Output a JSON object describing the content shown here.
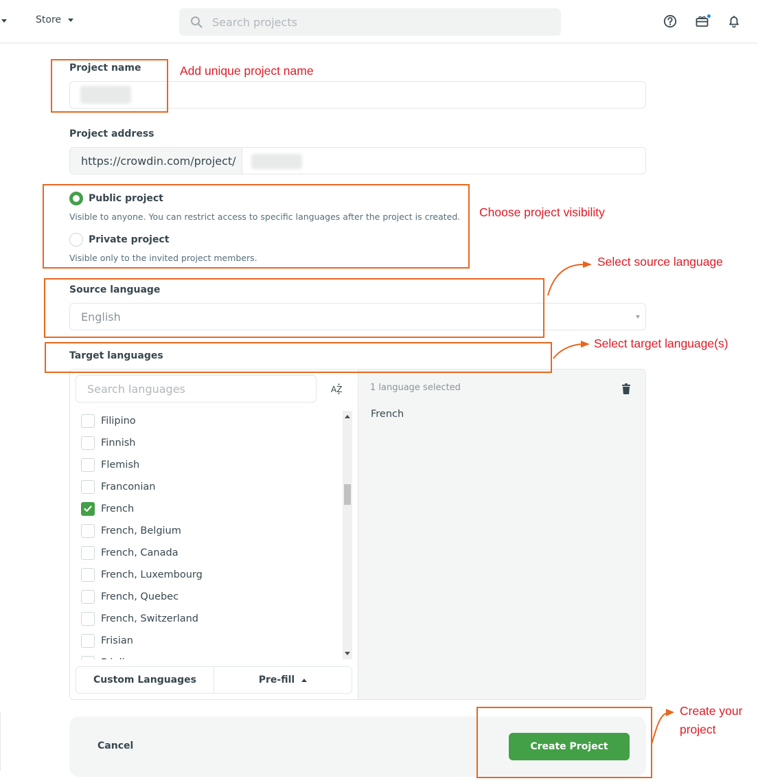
{
  "topbar": {
    "store_label": "Store",
    "search_placeholder": "Search projects",
    "icons": [
      "help-circle-icon",
      "gift-icon",
      "bell-icon"
    ]
  },
  "form": {
    "project_name": {
      "label": "Project name",
      "value": ""
    },
    "project_address": {
      "label": "Project address",
      "prefix": "https://crowdin.com/project/",
      "value": ""
    },
    "visibility": {
      "options": [
        {
          "label": "Public project",
          "description": "Visible to anyone. You can restrict access to specific languages after the project is created.",
          "selected": true
        },
        {
          "label": "Private project",
          "description": "Visible only to the invited project members.",
          "selected": false
        }
      ]
    },
    "source_language": {
      "label": "Source language",
      "value": "English"
    },
    "target_languages": {
      "label": "Target languages",
      "search_placeholder": "Search languages",
      "sort_label": "AZ",
      "items": [
        {
          "name": "Filipino",
          "checked": false
        },
        {
          "name": "Finnish",
          "checked": false
        },
        {
          "name": "Flemish",
          "checked": false
        },
        {
          "name": "Franconian",
          "checked": false
        },
        {
          "name": "French",
          "checked": true
        },
        {
          "name": "French, Belgium",
          "checked": false
        },
        {
          "name": "French, Canada",
          "checked": false
        },
        {
          "name": "French, Luxembourg",
          "checked": false
        },
        {
          "name": "French, Quebec",
          "checked": false
        },
        {
          "name": "French, Switzerland",
          "checked": false
        },
        {
          "name": "Frisian",
          "checked": false
        },
        {
          "name": "Friulian",
          "checked": false
        }
      ],
      "custom_languages_label": "Custom Languages",
      "prefill_label": "Pre-fill",
      "selected_count_text": "1 language selected",
      "selected": [
        "French"
      ]
    }
  },
  "footer": {
    "cancel_label": "Cancel",
    "create_label": "Create Project"
  },
  "annotations": {
    "name_hint": "Add unique project name",
    "visibility_hint": "Choose project visibility",
    "source_hint": "Select source language",
    "target_hint": "Select target language(s)",
    "create_hint_line1": "Create your",
    "create_hint_line2": "project",
    "colors": {
      "box": "#e8661f",
      "text": "#e01b24"
    }
  },
  "colors": {
    "accent_green": "#43a047",
    "notification_dot": "#1e88e5"
  }
}
